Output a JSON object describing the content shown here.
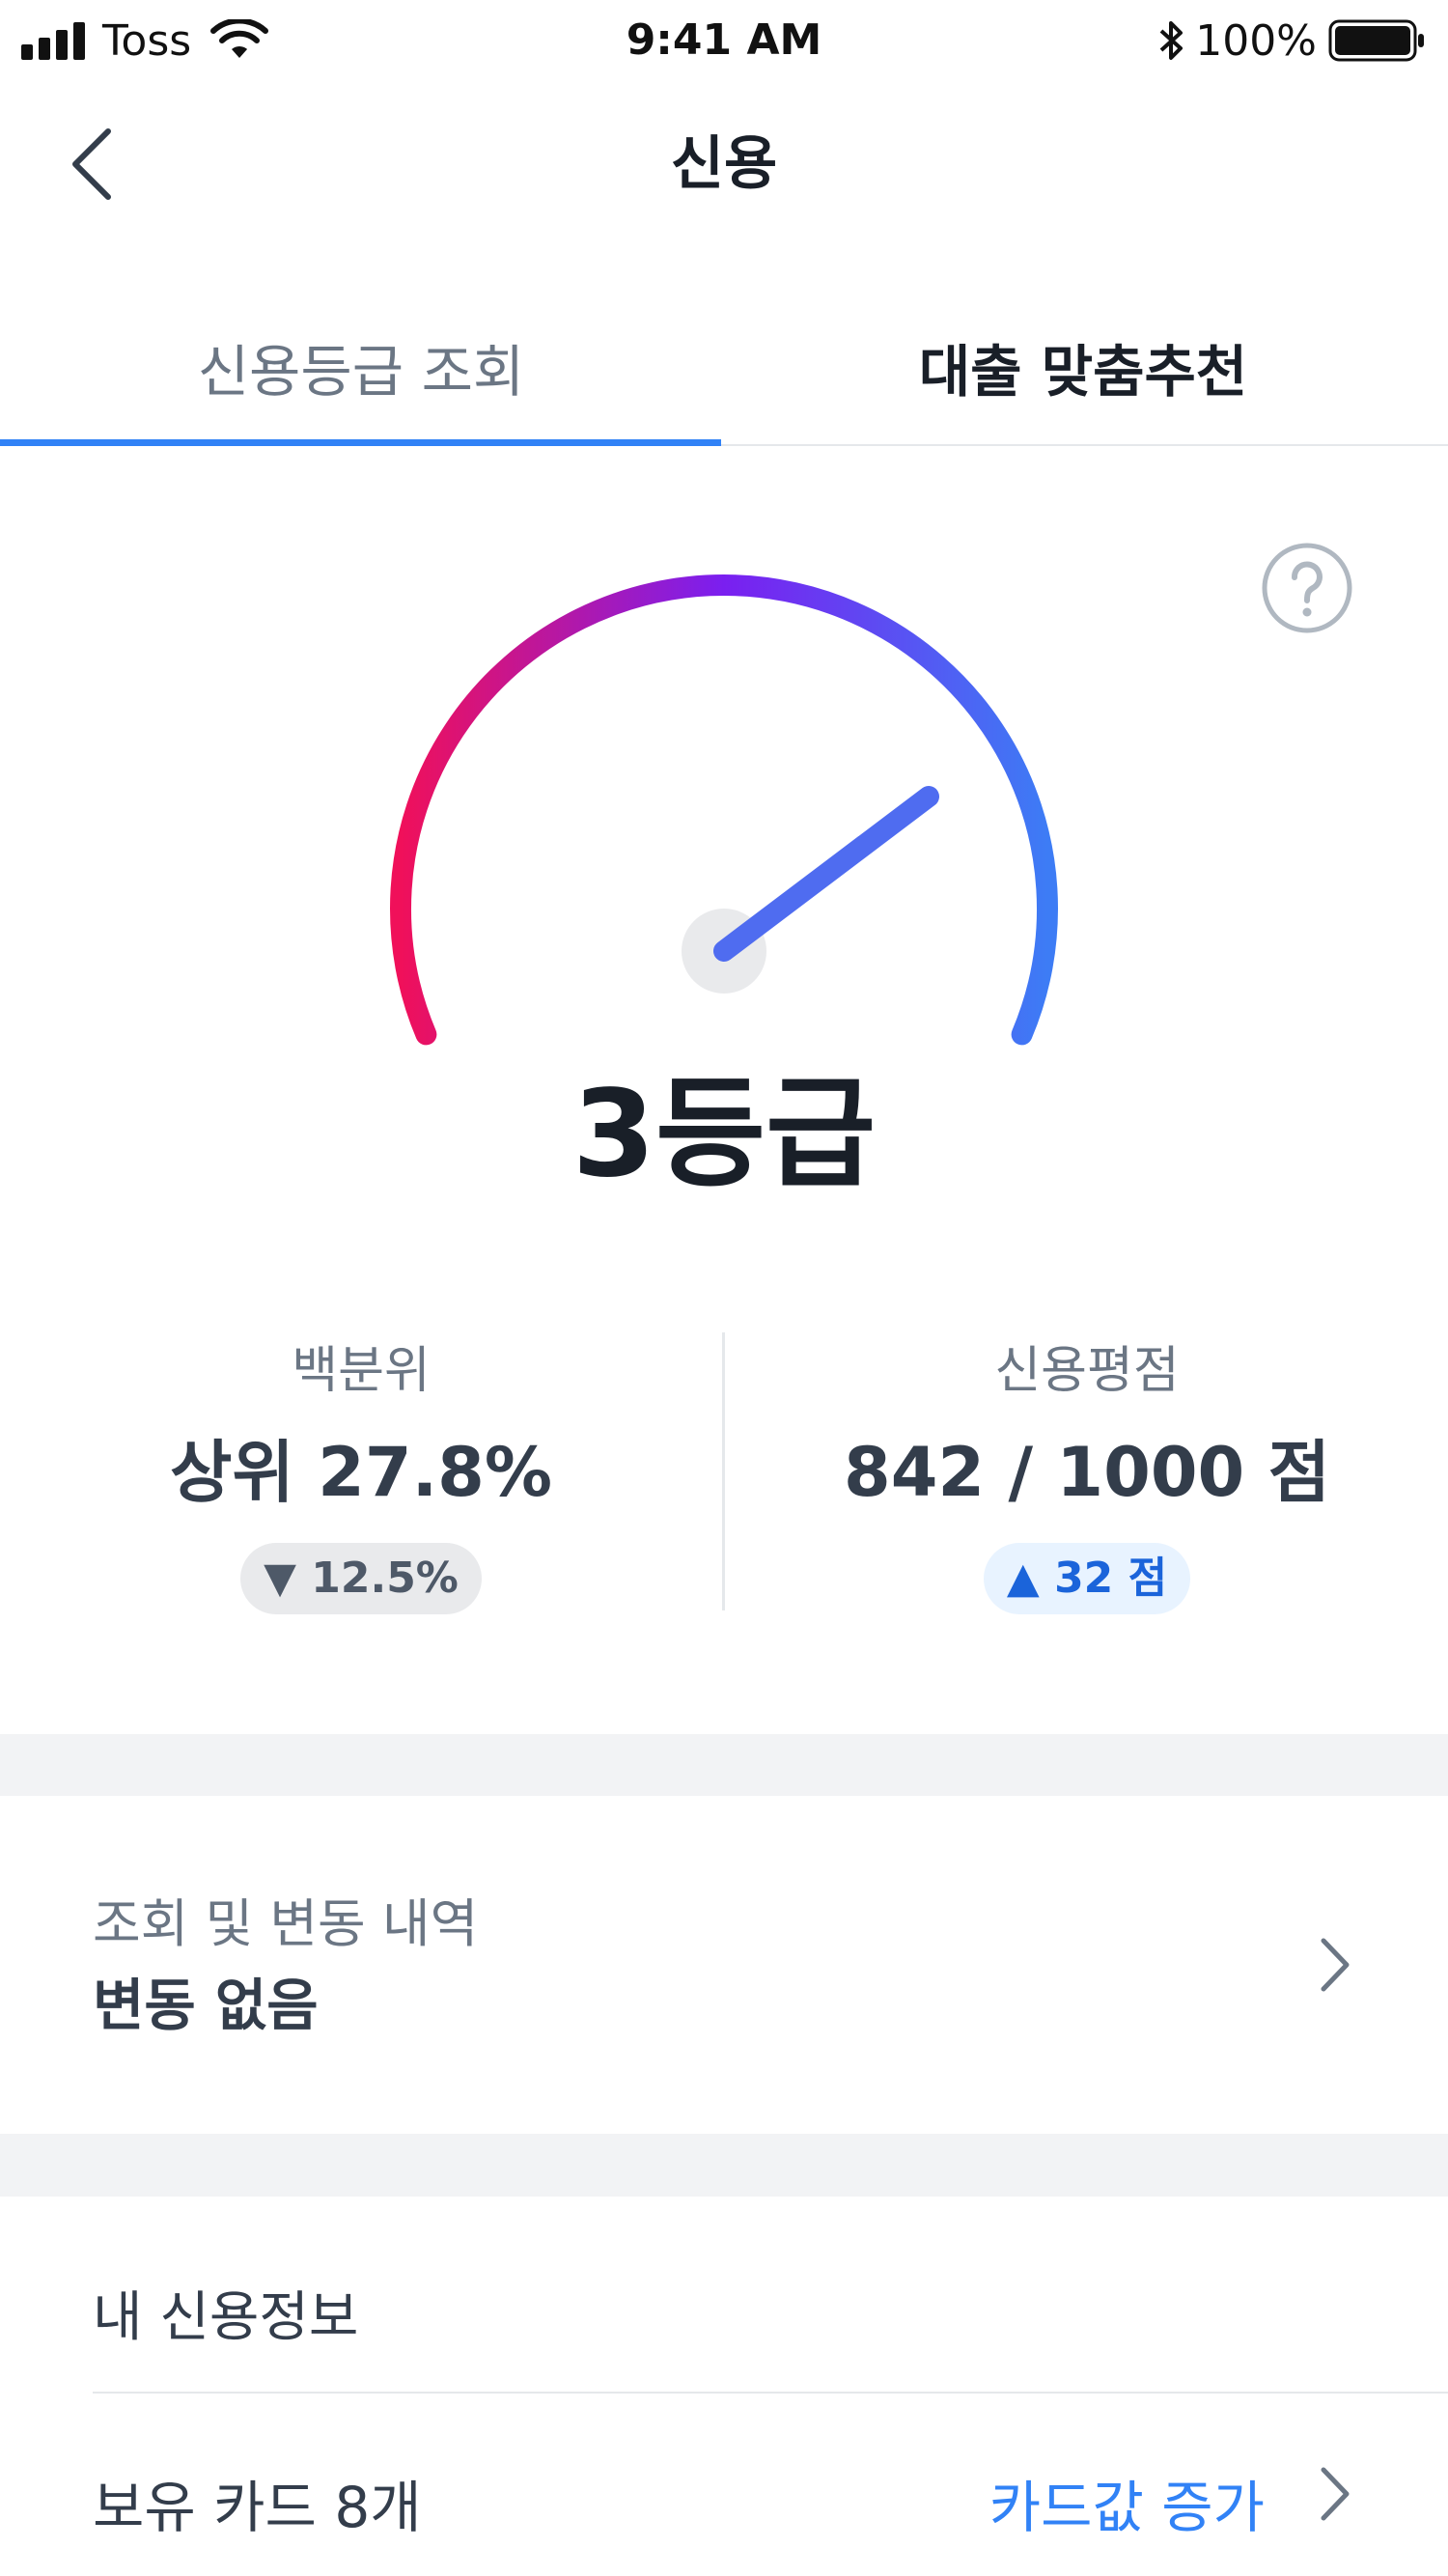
{
  "status_bar": {
    "carrier": "Toss",
    "time": "9:41 AM",
    "battery": "100%"
  },
  "nav": {
    "title": "신용",
    "back_icon": "chevron-left-icon"
  },
  "tabs": [
    {
      "label": "신용등급 조회",
      "selected": true
    },
    {
      "label": "대출 맞춤추천",
      "selected": false
    }
  ],
  "gauge": {
    "help_icon": "question-circle-icon",
    "grade": "3등급"
  },
  "stats": {
    "percentile": {
      "label": "백분위",
      "value": "상위 27.8%",
      "change": "▼ 12.5%"
    },
    "score": {
      "label": "신용평점",
      "value": "842 / 1000 점",
      "change": "▲ 32 점"
    }
  },
  "history": {
    "label": "조회 및 변동 내역",
    "value": "변동 없음"
  },
  "credit_info": {
    "title": "내 신용정보",
    "cards": {
      "label": "보유 카드 8개",
      "action": "카드값 증가"
    }
  },
  "colors": {
    "accent": "#3182f6",
    "gauge_start": "#f0105a",
    "gauge_mid": "#7a1ff0",
    "gauge_end": "#3d7cf5",
    "needle": "#4f6cf0"
  }
}
